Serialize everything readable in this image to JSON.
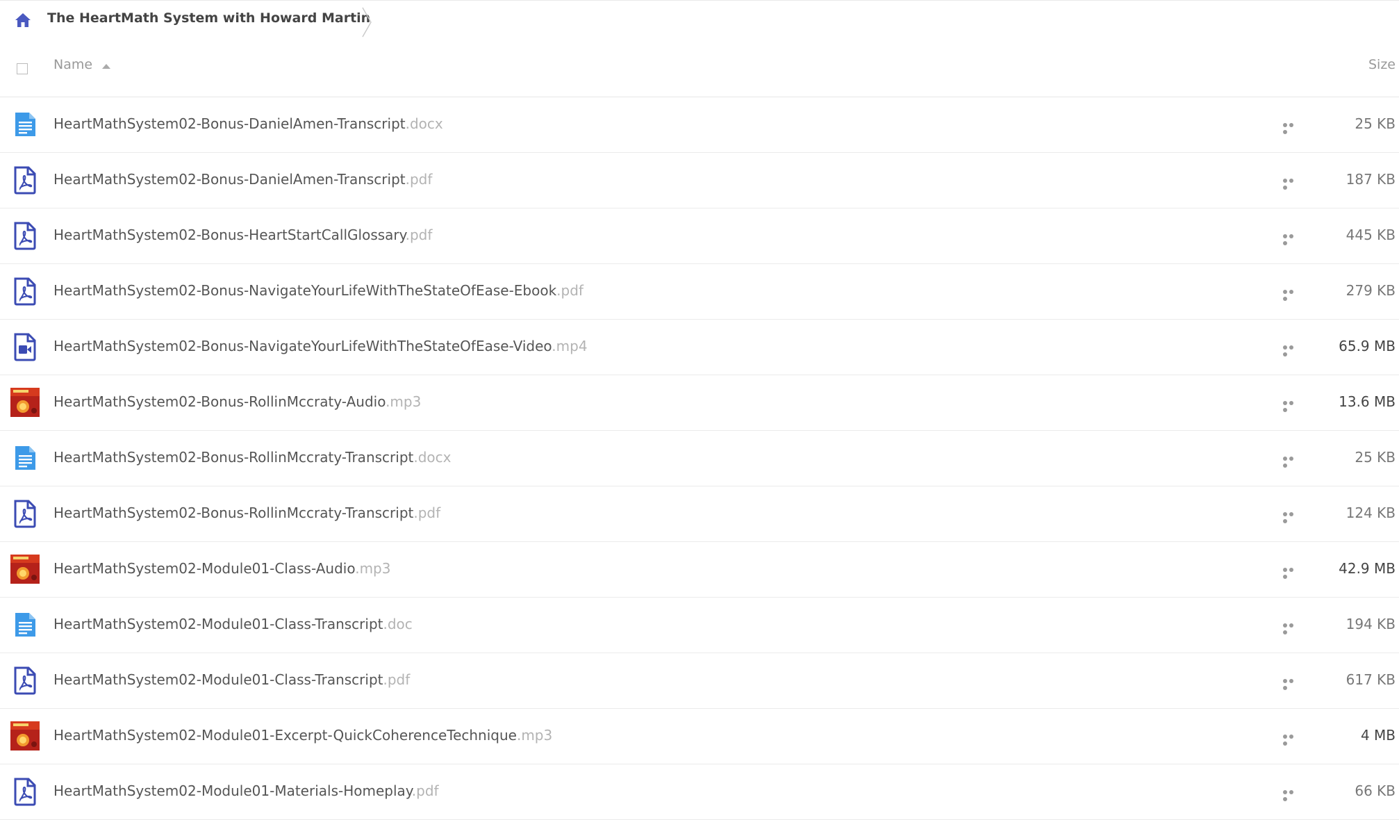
{
  "breadcrumb": {
    "home_icon": "home-icon",
    "title": "The HeartMath System with Howard Martin"
  },
  "columns": {
    "name_label": "Name",
    "size_label": "Size",
    "sort": "ascending"
  },
  "colors": {
    "doc_icon": "#3d9ae8",
    "pdf_icon": "#3b4bb3",
    "video_icon": "#3b4bb3",
    "audio_thumb": "#b5221a"
  },
  "files": [
    {
      "base": "HeartMathSystem02-Bonus-DanielAmen-Transcript",
      "ext": ".docx",
      "size": "25 KB",
      "icon": "doc-icon"
    },
    {
      "base": "HeartMathSystem02-Bonus-DanielAmen-Transcript",
      "ext": ".pdf",
      "size": "187 KB",
      "icon": "pdf-icon"
    },
    {
      "base": "HeartMathSystem02-Bonus-HeartStartCallGlossary",
      "ext": ".pdf",
      "size": "445 KB",
      "icon": "pdf-icon"
    },
    {
      "base": "HeartMathSystem02-Bonus-NavigateYourLifeWithTheStateOfEase-Ebook",
      "ext": ".pdf",
      "size": "279 KB",
      "icon": "pdf-icon"
    },
    {
      "base": "HeartMathSystem02-Bonus-NavigateYourLifeWithTheStateOfEase-Video",
      "ext": ".mp4",
      "size": "65.9 MB",
      "icon": "video-icon"
    },
    {
      "base": "HeartMathSystem02-Bonus-RollinMccraty-Audio",
      "ext": ".mp3",
      "size": "13.6 MB",
      "icon": "audio-thumbnail-icon"
    },
    {
      "base": "HeartMathSystem02-Bonus-RollinMccraty-Transcript",
      "ext": ".docx",
      "size": "25 KB",
      "icon": "doc-icon"
    },
    {
      "base": "HeartMathSystem02-Bonus-RollinMccraty-Transcript",
      "ext": ".pdf",
      "size": "124 KB",
      "icon": "pdf-icon"
    },
    {
      "base": "HeartMathSystem02-Module01-Class-Audio",
      "ext": ".mp3",
      "size": "42.9 MB",
      "icon": "audio-thumbnail-icon"
    },
    {
      "base": "HeartMathSystem02-Module01-Class-Transcript",
      "ext": ".doc",
      "size": "194 KB",
      "icon": "doc-icon"
    },
    {
      "base": "HeartMathSystem02-Module01-Class-Transcript",
      "ext": ".pdf",
      "size": "617 KB",
      "icon": "pdf-icon"
    },
    {
      "base": "HeartMathSystem02-Module01-Excerpt-QuickCoherenceTechnique",
      "ext": ".mp3",
      "size": "4 MB",
      "icon": "audio-thumbnail-icon"
    },
    {
      "base": "HeartMathSystem02-Module01-Materials-Homeplay",
      "ext": ".pdf",
      "size": "66 KB",
      "icon": "pdf-icon"
    }
  ]
}
